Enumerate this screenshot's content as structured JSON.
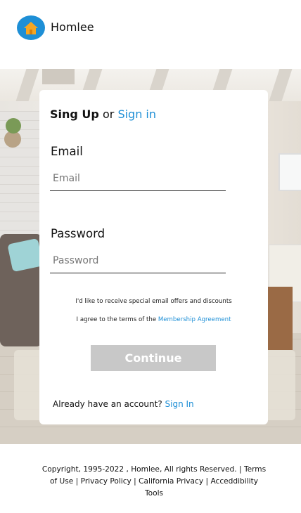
{
  "header": {
    "brand": "Homlee",
    "logo_icon": "home-icon"
  },
  "colors": {
    "accent": "#1e8fd6",
    "button_disabled": "#c8c8c8",
    "logo_bg": "#1e8fd6",
    "logo_house": "#f5a623"
  },
  "card": {
    "title_strong": "Sing Up",
    "title_or": "or",
    "title_link": "Sign in",
    "email_label": "Email",
    "email_placeholder": "Email",
    "password_label": "Password",
    "password_placeholder": "Password",
    "offers_text": "I'd like to receive special email offers and discounts",
    "terms_text": "I agree to the terms of the",
    "terms_link": "Membership Agreement",
    "continue_label": "Continue",
    "already_text": "Already have an account?",
    "already_link": "Sign In"
  },
  "footer": {
    "text": "Copyright, 1995-2022 , Homlee, All rights Reserved. | Terms of Use | Privacy Policy | California Privacy | Acceddibility Tools"
  }
}
